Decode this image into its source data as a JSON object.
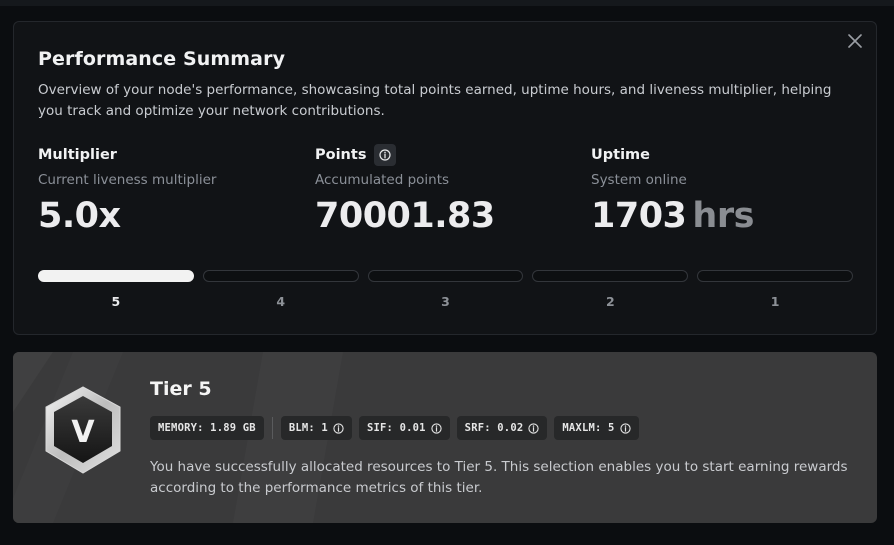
{
  "summary": {
    "title": "Performance Summary",
    "description": "Overview of your node's performance, showcasing total points earned, uptime hours, and liveness multiplier, helping you track and optimize your network contributions.",
    "close_icon": "close-icon",
    "metrics": [
      {
        "label": "Multiplier",
        "sublabel": "Current liveness multiplier",
        "value": "5.0x",
        "unit": ""
      },
      {
        "label": "Points",
        "sublabel": "Accumulated points",
        "value": "70001.83",
        "unit": "",
        "icon": "info-icon"
      },
      {
        "label": "Uptime",
        "sublabel": "System online",
        "value": "1703",
        "unit": "hrs"
      }
    ],
    "tiers": {
      "labels": [
        "5",
        "4",
        "3",
        "2",
        "1"
      ],
      "active": "5"
    }
  },
  "tier_card": {
    "title": "Tier 5",
    "badge_letter": "V",
    "specs": [
      {
        "text": "MEMORY: 1.89 GB",
        "info": false
      },
      {
        "text": "BLM: 1",
        "info": true
      },
      {
        "text": "SIF: 0.01",
        "info": true
      },
      {
        "text": "SRF: 0.02",
        "info": true
      },
      {
        "text": "MAXLM: 5",
        "info": true
      }
    ],
    "description": "You have successfully allocated resources to Tier 5. This selection enables you to start earning rewards according to the performance metrics of this tier."
  }
}
